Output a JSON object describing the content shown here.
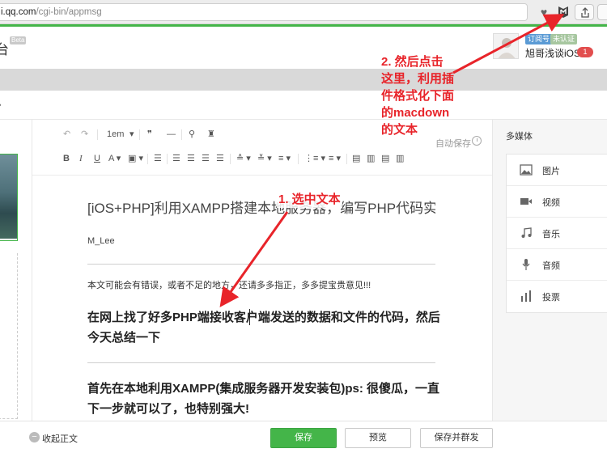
{
  "browser": {
    "url_visible": "i.qq.com",
    "url_rest": "/cgi-bin/appmsg"
  },
  "header": {
    "platform_title_fragment": "台",
    "beta_label": "Beta",
    "account_type_badge": "订阅号",
    "verify_badge": "未认证",
    "account_name": "旭哥浅谈iOS",
    "notification_count": "1"
  },
  "editor": {
    "toolbar": {
      "undo_icon": "undo-icon",
      "redo_icon": "redo-icon",
      "line_height": "1em",
      "autosave_label": "自动保存"
    },
    "content": {
      "title": "[iOS+PHP]利用XAMPP搭建本地服务器，编写PHP代码实现",
      "author": "M_Lee",
      "note": "本文可能会有错误，或者不足的地方，还请多多指正，多多提宝贵意见!!!",
      "heading1": "在网上找了好多PHP端接收客户端发送的数据和文件的代码，然后今天总结一下",
      "heading2": "首先在本地利用XAMPP(集成服务器开发安装包)ps: 很傻瓜，一直下一步就可以了，也特别强大!"
    }
  },
  "media_panel": {
    "title": "多媒体",
    "items": [
      {
        "label": "图片",
        "icon": "image-icon"
      },
      {
        "label": "视频",
        "icon": "video-icon"
      },
      {
        "label": "音乐",
        "icon": "music-icon"
      },
      {
        "label": "音频",
        "icon": "microphone-icon"
      },
      {
        "label": "投票",
        "icon": "poll-icon"
      }
    ]
  },
  "footer": {
    "collapse_label": "收起正文",
    "save_label": "保存",
    "preview_label": "预览",
    "publish_label": "保存并群发"
  },
  "annotations": {
    "step1": "1. 选中文本",
    "step2_lines": [
      "2. 然后点击",
      "这里，利用插",
      "件格式化下面",
      "的macdown",
      "的文本"
    ],
    "color": "#e8242a"
  }
}
